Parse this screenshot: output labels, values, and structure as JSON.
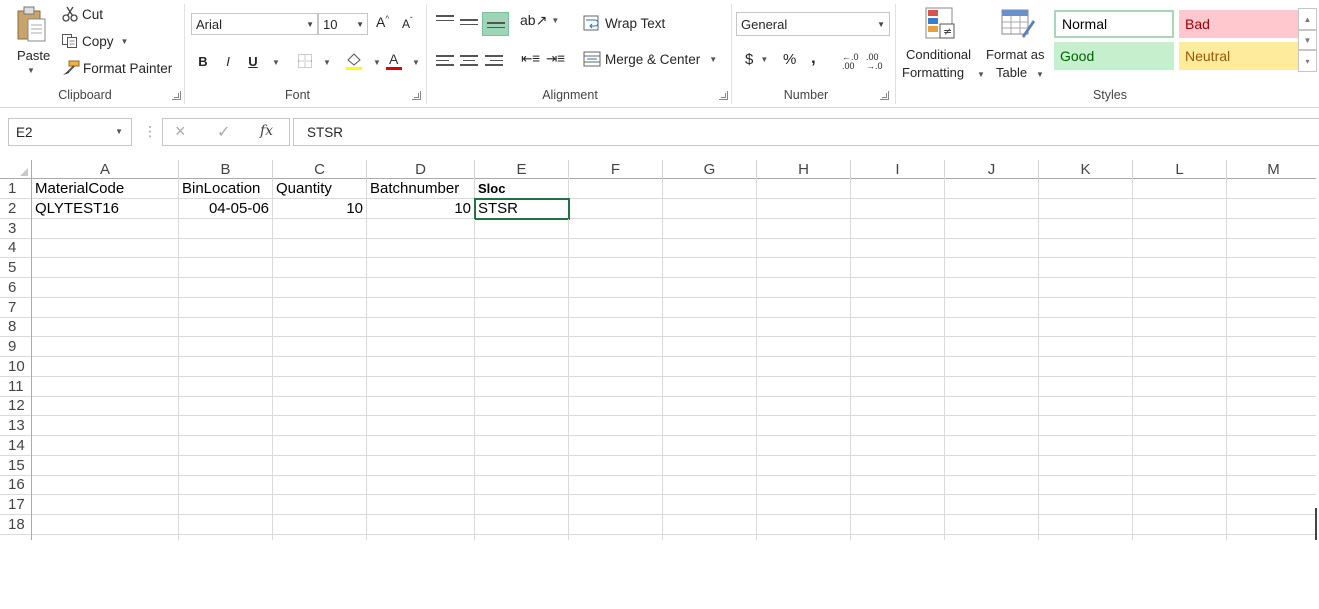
{
  "ribbon": {
    "clipboard": {
      "paste": "Paste",
      "cut": "Cut",
      "copy": "Copy",
      "format_painter": "Format Painter",
      "label": "Clipboard"
    },
    "font": {
      "name": "Arial",
      "size": "10",
      "bold": "B",
      "italic": "I",
      "underline": "U",
      "label": "Font"
    },
    "alignment": {
      "wrap_text": "Wrap Text",
      "merge_center": "Merge & Center",
      "label": "Alignment"
    },
    "number": {
      "format": "General",
      "currency": "$",
      "percent": "%",
      "comma": ",",
      "label": "Number"
    },
    "styles": {
      "conditional_formatting_1": "Conditional",
      "conditional_formatting_2": "Formatting",
      "format_as_table_1": "Format as",
      "format_as_table_2": "Table",
      "normal": "Normal",
      "bad": "Bad",
      "good": "Good",
      "neutral": "Neutral",
      "label": "Styles",
      "colors": {
        "normal_border": "#a9d6b8",
        "bad_bg": "#ffc7ce",
        "bad_fg": "#9c0006",
        "good_bg": "#c6efce",
        "good_fg": "#006100",
        "neutral_bg": "#ffeb9c",
        "neutral_fg": "#9c5700"
      }
    }
  },
  "formula_bar": {
    "name_box": "E2",
    "cancel": "×",
    "enter": "✓",
    "fx": "fx",
    "content": "STSR"
  },
  "grid": {
    "columns": [
      "A",
      "B",
      "C",
      "D",
      "E",
      "F",
      "G",
      "H",
      "I",
      "J",
      "K",
      "L",
      "M"
    ],
    "rows": [
      "1",
      "2",
      "3",
      "4",
      "5",
      "6",
      "7",
      "8",
      "9",
      "10",
      "11",
      "12",
      "13",
      "14",
      "15",
      "16",
      "17",
      "18"
    ],
    "row1": [
      "MaterialCode",
      "BinLocation",
      "Quantity",
      "Batchnumber",
      "Sloc"
    ],
    "row2": [
      "QLYTEST16",
      "04-05-06",
      "10",
      "10",
      "STSR"
    ],
    "selected_cell": "E2"
  }
}
